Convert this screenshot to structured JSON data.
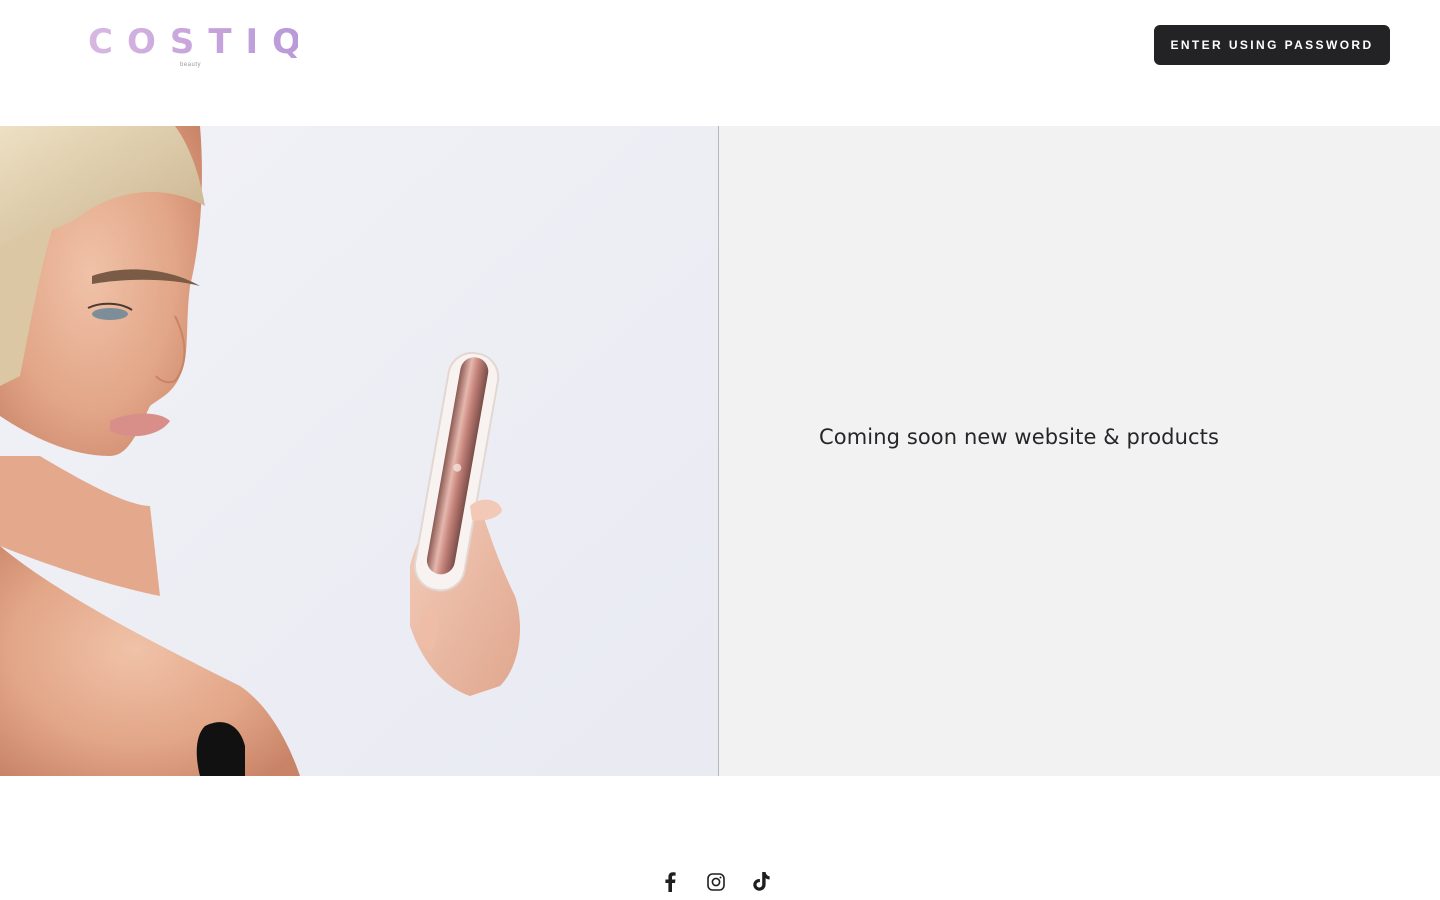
{
  "header": {
    "logo_text": "COSTIQ",
    "logo_subtext": "beauty",
    "enter_button_label": "ENTER USING PASSWORD"
  },
  "hero": {
    "image_alt": "Model holding rose gold lip product",
    "message": "Coming soon new website & products"
  },
  "footer": {
    "social_links": [
      {
        "name": "Facebook",
        "icon": "facebook-icon"
      },
      {
        "name": "Instagram",
        "icon": "instagram-icon"
      },
      {
        "name": "TikTok",
        "icon": "tiktok-icon"
      }
    ]
  },
  "colors": {
    "button_bg": "#232326",
    "logo_gradient_start": "#d8b8e2",
    "logo_gradient_end": "#b99ad8",
    "hero_text_panel_bg": "#f2f2f2",
    "hero_image_bg": "#eeeff5"
  }
}
